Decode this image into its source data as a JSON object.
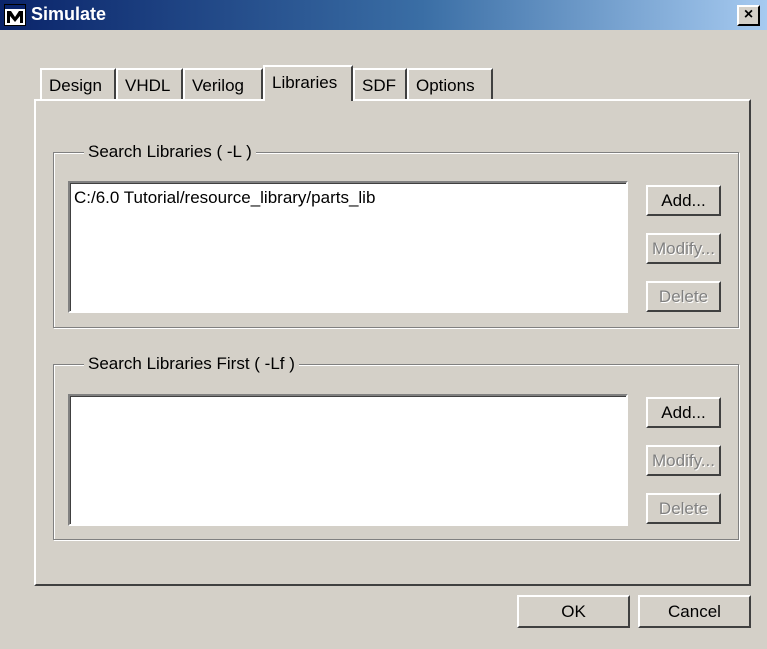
{
  "window": {
    "title": "Simulate",
    "close_label": "×"
  },
  "tabs": [
    {
      "label": "Design"
    },
    {
      "label": "VHDL"
    },
    {
      "label": "Verilog"
    },
    {
      "label": "Libraries"
    },
    {
      "label": "SDF"
    },
    {
      "label": "Options"
    }
  ],
  "active_tab": "Libraries",
  "search_libraries": {
    "title": "Search Libraries ( -L )",
    "items": [
      "C:/6.0 Tutorial/resource_library/parts_lib"
    ],
    "add_label": "Add...",
    "modify_label": "Modify...",
    "delete_label": "Delete"
  },
  "search_libraries_first": {
    "title": "Search Libraries First ( -Lf )",
    "items": [],
    "add_label": "Add...",
    "modify_label": "Modify...",
    "delete_label": "Delete"
  },
  "footer": {
    "ok_label": "OK",
    "cancel_label": "Cancel"
  },
  "colors": {
    "face": "#d4d0c8",
    "title_start": "#0a246a",
    "title_end": "#a6caf0",
    "disabled_text": "#808080"
  },
  "icons": {
    "app": "modelsim-m-icon",
    "close": "close-icon"
  }
}
